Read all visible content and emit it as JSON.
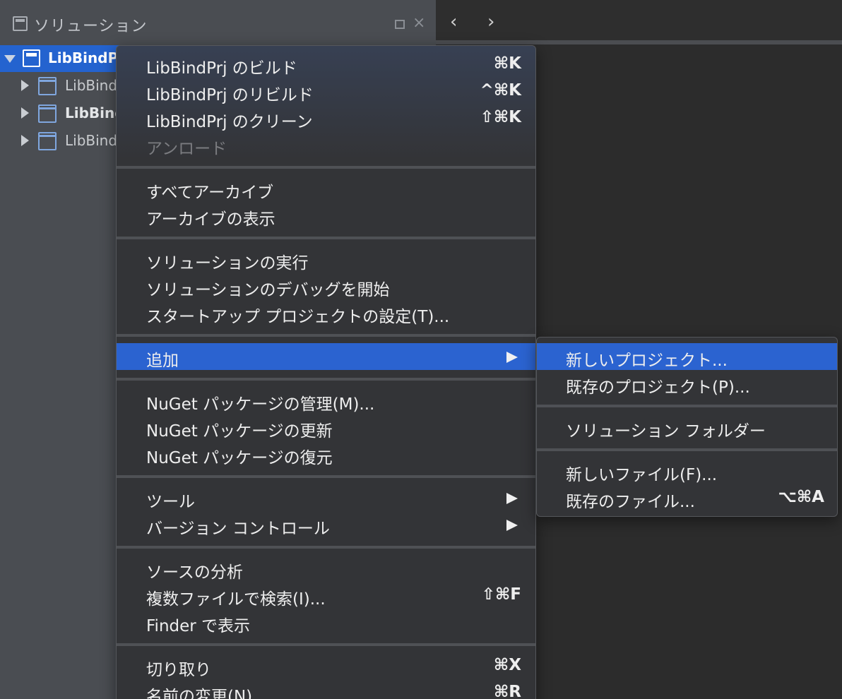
{
  "pad": {
    "title": "ソリューション",
    "close_glyph": "×"
  },
  "tree": {
    "root_label": "LibBindPrj",
    "children": [
      "LibBind",
      "LibBind",
      "LibBind"
    ]
  },
  "editor": {
    "back_glyph": "‹",
    "forward_glyph": "›"
  },
  "menu": {
    "items": [
      {
        "label": "LibBindPrj のビルド",
        "shortcut": "⌘K"
      },
      {
        "label": "LibBindPrj のリビルド",
        "shortcut": "^⌘K"
      },
      {
        "label": "LibBindPrj のクリーン",
        "shortcut": "⇧⌘K"
      },
      {
        "label": "アンロード",
        "shortcut": "",
        "disabled": true
      },
      {
        "label": "すべてアーカイブ",
        "shortcut": ""
      },
      {
        "label": "アーカイブの表示",
        "shortcut": ""
      },
      {
        "label": "ソリューションの実行",
        "shortcut": ""
      },
      {
        "label": "ソリューションのデバッグを開始",
        "shortcut": ""
      },
      {
        "label": "スタートアップ プロジェクトの設定(T)...",
        "shortcut": ""
      },
      {
        "label": "追加",
        "shortcut": "",
        "submenu": true,
        "highlighted": true
      },
      {
        "label": "NuGet パッケージの管理(M)...",
        "shortcut": ""
      },
      {
        "label": "NuGet パッケージの更新",
        "shortcut": ""
      },
      {
        "label": "NuGet パッケージの復元",
        "shortcut": ""
      },
      {
        "label": "ツール",
        "shortcut": "",
        "submenu": true
      },
      {
        "label": "バージョン コントロール",
        "shortcut": "",
        "submenu": true
      },
      {
        "label": "ソースの分析",
        "shortcut": ""
      },
      {
        "label": "複数ファイルで検索(I)...",
        "shortcut": "⇧⌘F"
      },
      {
        "label": "Finder で表示",
        "shortcut": ""
      },
      {
        "label": "切り取り",
        "shortcut": "⌘X"
      },
      {
        "label": "名前の変更(N)...",
        "shortcut": "⌘R"
      }
    ]
  },
  "submenu": {
    "items": [
      {
        "label": "新しいプロジェクト...",
        "shortcut": "",
        "highlighted": true
      },
      {
        "label": "既存のプロジェクト(P)...",
        "shortcut": ""
      },
      {
        "label": "ソリューション フォルダー",
        "shortcut": ""
      },
      {
        "label": "新しいファイル(F)...",
        "shortcut": ""
      },
      {
        "label": "既存のファイル...",
        "shortcut": "⌥⌘A"
      }
    ]
  },
  "colors": {
    "highlight": "#2b63d0",
    "menu_bg": "#333437",
    "pad_bg": "#4a4d52"
  }
}
